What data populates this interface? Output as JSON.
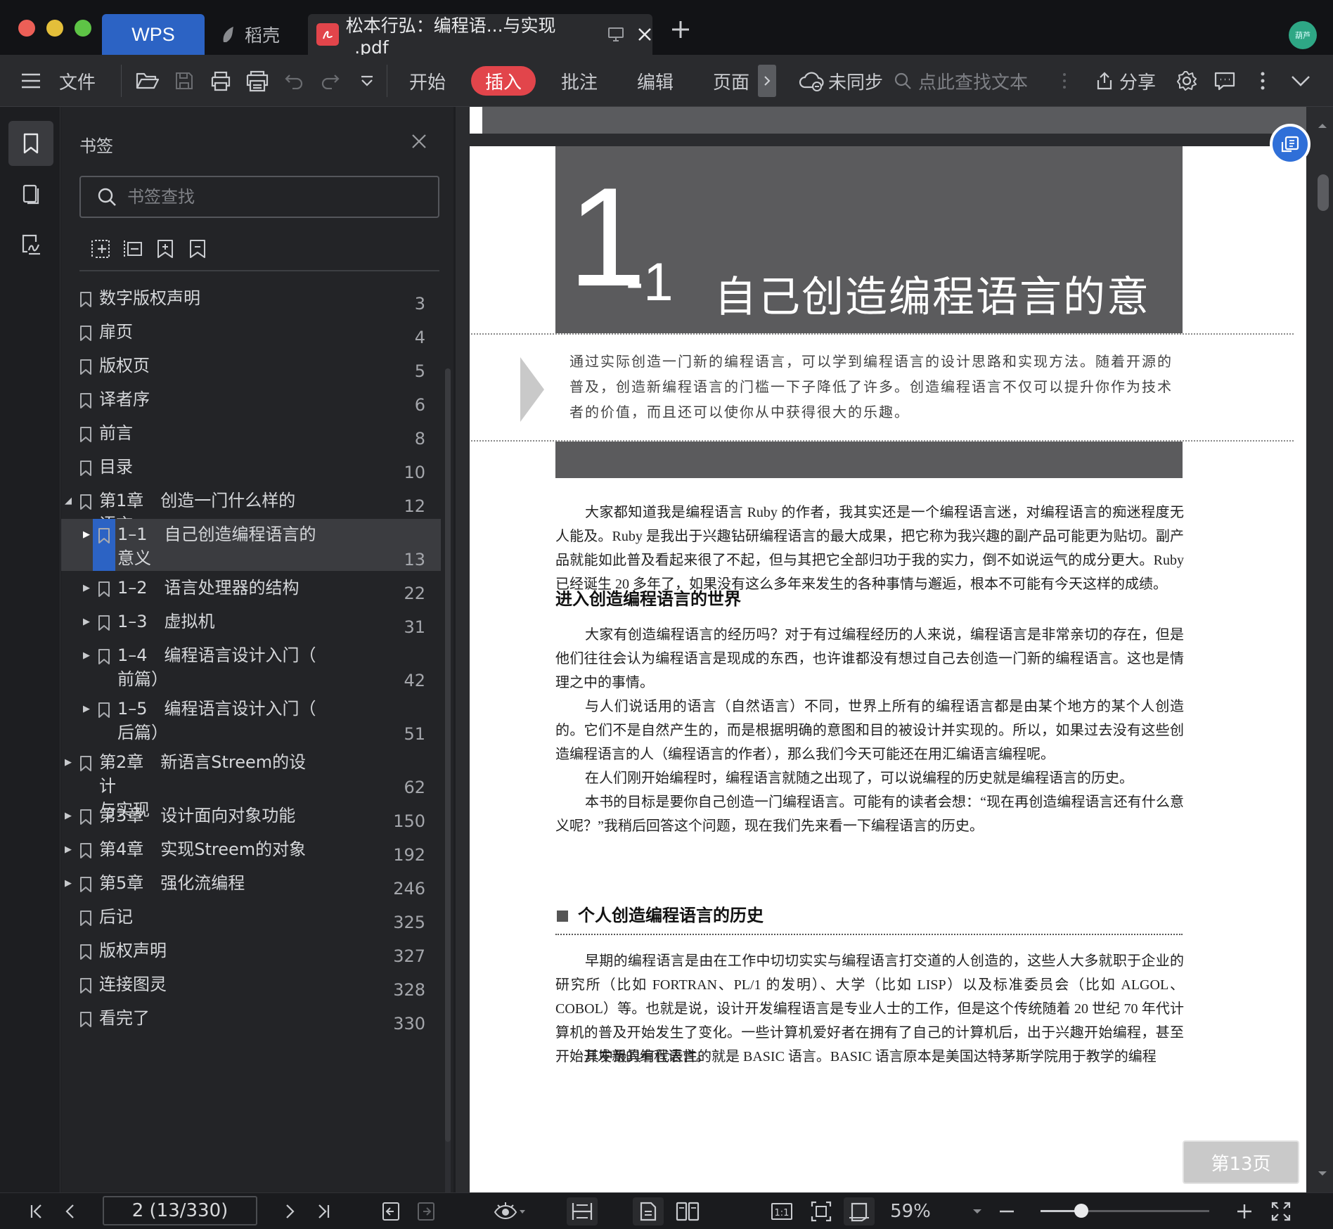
{
  "window": {
    "tabs": {
      "wps": "WPS",
      "daoke": "稻壳",
      "document": "松本行弘：编程语...与实现_.pdf"
    },
    "avatar_text": "葫芦"
  },
  "toolbar": {
    "file": "文件",
    "tabs": [
      "开始",
      "插入",
      "批注",
      "编辑",
      "页面"
    ],
    "active_tab": "插入",
    "sync_status": "未同步",
    "search_placeholder": "点此查找文本",
    "share": "分享",
    "accent_color": "#e2454b"
  },
  "bookmark_panel": {
    "title": "书签",
    "search_placeholder": "书签查找",
    "items": [
      {
        "label": "数字版权声明",
        "page": "3"
      },
      {
        "label": "扉页",
        "page": "4"
      },
      {
        "label": "版权页",
        "page": "5"
      },
      {
        "label": "译者序",
        "page": "6"
      },
      {
        "label": "前言",
        "page": "8"
      },
      {
        "label": "目录",
        "page": "10"
      },
      {
        "label": "第1章　创造一门什么样的语言",
        "page": "12"
      },
      {
        "label": "1–1　自己创造编程语言的\n意义",
        "page": "13"
      },
      {
        "label": "1–2　语言处理器的结构",
        "page": "22"
      },
      {
        "label": "1–3　虚拟机",
        "page": "31"
      },
      {
        "label": "1–4　编程语言设计入门（\n前篇）",
        "page": "42"
      },
      {
        "label": "1–5　编程语言设计入门（\n后篇）",
        "page": "51"
      },
      {
        "label": "第2章　新语言Streem的设计\n与实现",
        "page": "62"
      },
      {
        "label": "第3章　设计面向对象功能",
        "page": "150"
      },
      {
        "label": "第4章　实现Streem的对象",
        "page": "192"
      },
      {
        "label": "第5章　强化流编程",
        "page": "246"
      },
      {
        "label": "后记",
        "page": "325"
      },
      {
        "label": "版权声明",
        "page": "327"
      },
      {
        "label": "连接图灵",
        "page": "328"
      },
      {
        "label": "看完了",
        "page": "330"
      }
    ]
  },
  "document": {
    "chapter_number": "1",
    "chapter_sub": "-1",
    "chapter_title": "自己创造编程语言的意义",
    "intro": "通过实际创造一门新的编程语言，可以学到编程语言的设计思路和实现方法。随着开源的普及，创造新编程语言的门槛一下子降低了许多。创造编程语言不仅可以提升你作为技术者的价值，而且还可以使你从中获得很大的乐趣。",
    "para1": "大家都知道我是编程语言 Ruby 的作者，我其实还是一个编程语言迷，对编程语言的痴迷程度无人能及。Ruby 是我出于兴趣钻研编程语言的最大成果，把它称为我兴趣的副产品可能更为贴切。副产品就能如此普及看起来很了不起，但与其把它全部归功于我的实力，倒不如说运气的成分更大。Ruby 已经诞生 20 多年了，如果没有这么多年来发生的各种事情与邂逅，根本不可能有今天这样的成绩。",
    "section1_title": "进入创造编程语言的世界",
    "para2": "大家有创造编程语言的经历吗？对于有过编程经历的人来说，编程语言是非常亲切的存在，但是他们往往会认为编程语言是现成的东西，也许谁都没有想过自己去创造一门新的编程语言。这也是情理之中的事情。",
    "para3": "与人们说话用的语言（自然语言）不同，世界上所有的编程语言都是由某个地方的某个人创造的。它们不是自然产生的，而是根据明确的意图和目的被设计并实现的。所以，如果过去没有这些创造编程语言的人（编程语言的作者），那么我们今天可能还在用汇编语言编程呢。",
    "para4": "在人们刚开始编程时，编程语言就随之出现了，可以说编程的历史就是编程语言的历史。",
    "para5": "本书的目标是要你自己创造一门编程语言。可能有的读者会想：“现在再创造编程语言还有什么意义呢？”我稍后回答这个问题，现在我们先来看一下编程语言的历史。",
    "section2_title": "个人创造编程语言的历史",
    "para6": "早期的编程语言是由在工作中切切实实与编程语言打交道的人创造的，这些人大多就职于企业的研究所（比如 FORTRAN、PL/1 的发明）、大学（比如 LISP）以及标准委员会（比如 ALGOL、COBOL）等。也就是说，设计开发编程语言是专业人士的工作，但是这个传统随着 20 世纪 70 年代计算机的普及开始发生了变化。一些计算机爱好者在拥有了自己的计算机后，出于兴趣开始编程，甚至开始开发新的编程语言。",
    "para7": "其中最具有代表性的就是 BASIC 语言。BASIC 语言原本是美国达特茅斯学院用于教学的编程"
  },
  "page_badge": "第13页",
  "status_bar": {
    "page_indicator": "2 (13/330)",
    "zoom": "59%",
    "zoom_level": 0.59
  }
}
